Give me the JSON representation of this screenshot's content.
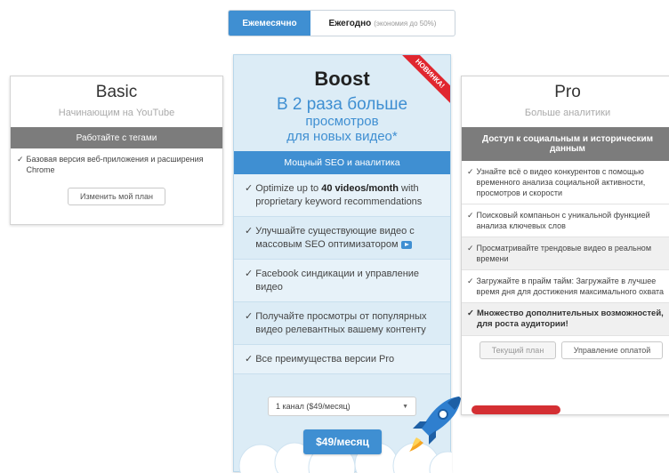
{
  "billing": {
    "monthly": "Ежемесячно",
    "yearly": "Ежегодно",
    "yearly_note": "(экономия до 50%)"
  },
  "basic": {
    "title": "Basic",
    "subtitle": "Начинающим на YouTube",
    "band": "Работайте с тегами",
    "features": [
      "Базовая версия веб-приложения и расширения Chrome"
    ],
    "button": "Изменить мой план"
  },
  "boost": {
    "title": "Boost",
    "ribbon": "НОВИНКА!",
    "tagline_line1": "В 2 раза больше",
    "tagline_line2": "просмотров",
    "tagline_line3": "для новых видео*",
    "band": "Мощный SEO и аналитика",
    "features": [
      {
        "before": "Optimize up to ",
        "bold": "40 videos/month",
        "after": " with proprietary keyword recommendations"
      },
      {
        "before": "Улучшайте существующие видео с массовым SEO оптимизатором",
        "bold": "",
        "after": ""
      },
      {
        "before": "Facebook синдикации и управление видео",
        "bold": "",
        "after": ""
      },
      {
        "before": "Получайте просмотры от популярных видео релевантных вашему контенту",
        "bold": "",
        "after": ""
      },
      {
        "before": "Все преимущества версии Pro",
        "bold": "",
        "after": ""
      }
    ],
    "select_value": "1 канал ($49/месяц)",
    "price_button": "$49/месяц"
  },
  "pro": {
    "title": "Pro",
    "subtitle": "Больше аналитики",
    "band": "Доступ к социальным и историческим данным",
    "features": [
      "Узнайте всё о видео конкурентов с помощью временного анализа социальной активности, просмотров и скорости",
      "Поисковый компаньон с уникальной функцией анализа ключевых слов",
      "Просматривайте трендовые видео в реальном времени",
      "Загружайте в прайм тайм: Загружайте в лучшее время дня для достижения максимального охвата",
      "Множество дополнительных возможностей, для роста аудитории!"
    ],
    "current_button": "Текущий план",
    "billing_button": "Управление оплатой"
  },
  "colors": {
    "accent": "#3f8fd2",
    "band_gray": "#7c7c7c",
    "ribbon_red": "#e0262f",
    "underline_red": "#d42f33",
    "boost_bg": "#dcecf6"
  },
  "icons": {
    "check": "check-icon",
    "video": "video-icon",
    "dropdown": "caret-down-icon",
    "rocket": "rocket-icon"
  },
  "check_mark": "✓",
  "caret": "▼"
}
